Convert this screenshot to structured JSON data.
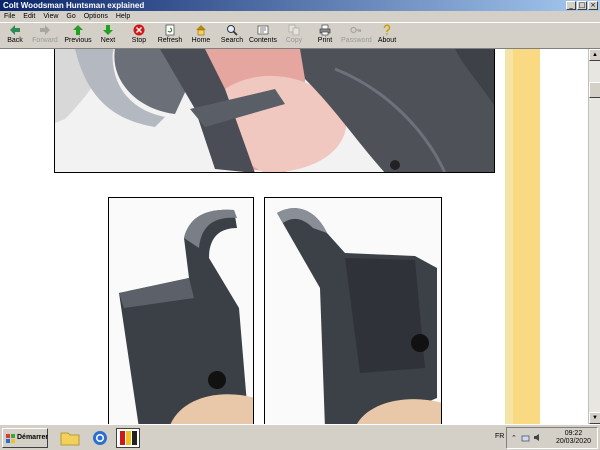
{
  "window": {
    "title": "Colt Woodsman Huntsman explained",
    "min_glyph": "_",
    "max_glyph": "□",
    "close_glyph": "×"
  },
  "menu": [
    "File",
    "Edit",
    "View",
    "Go",
    "Options",
    "Help"
  ],
  "toolbar": {
    "back": "Back",
    "forward": "Forward",
    "previous": "Previous",
    "next": "Next",
    "stop": "Stop",
    "refresh": "Refresh",
    "home": "Home",
    "search": "Search",
    "contents": "Contents",
    "copy": "Copy",
    "print": "Print",
    "password": "Password",
    "about": "About"
  },
  "taskbar": {
    "start_label": "Démarrer",
    "lang": "FR",
    "time": "09:22",
    "date": "20/03/2020"
  },
  "colors": {
    "title_start": "#0a246a",
    "title_end": "#a6caf0",
    "side_band": "#f9d981"
  }
}
